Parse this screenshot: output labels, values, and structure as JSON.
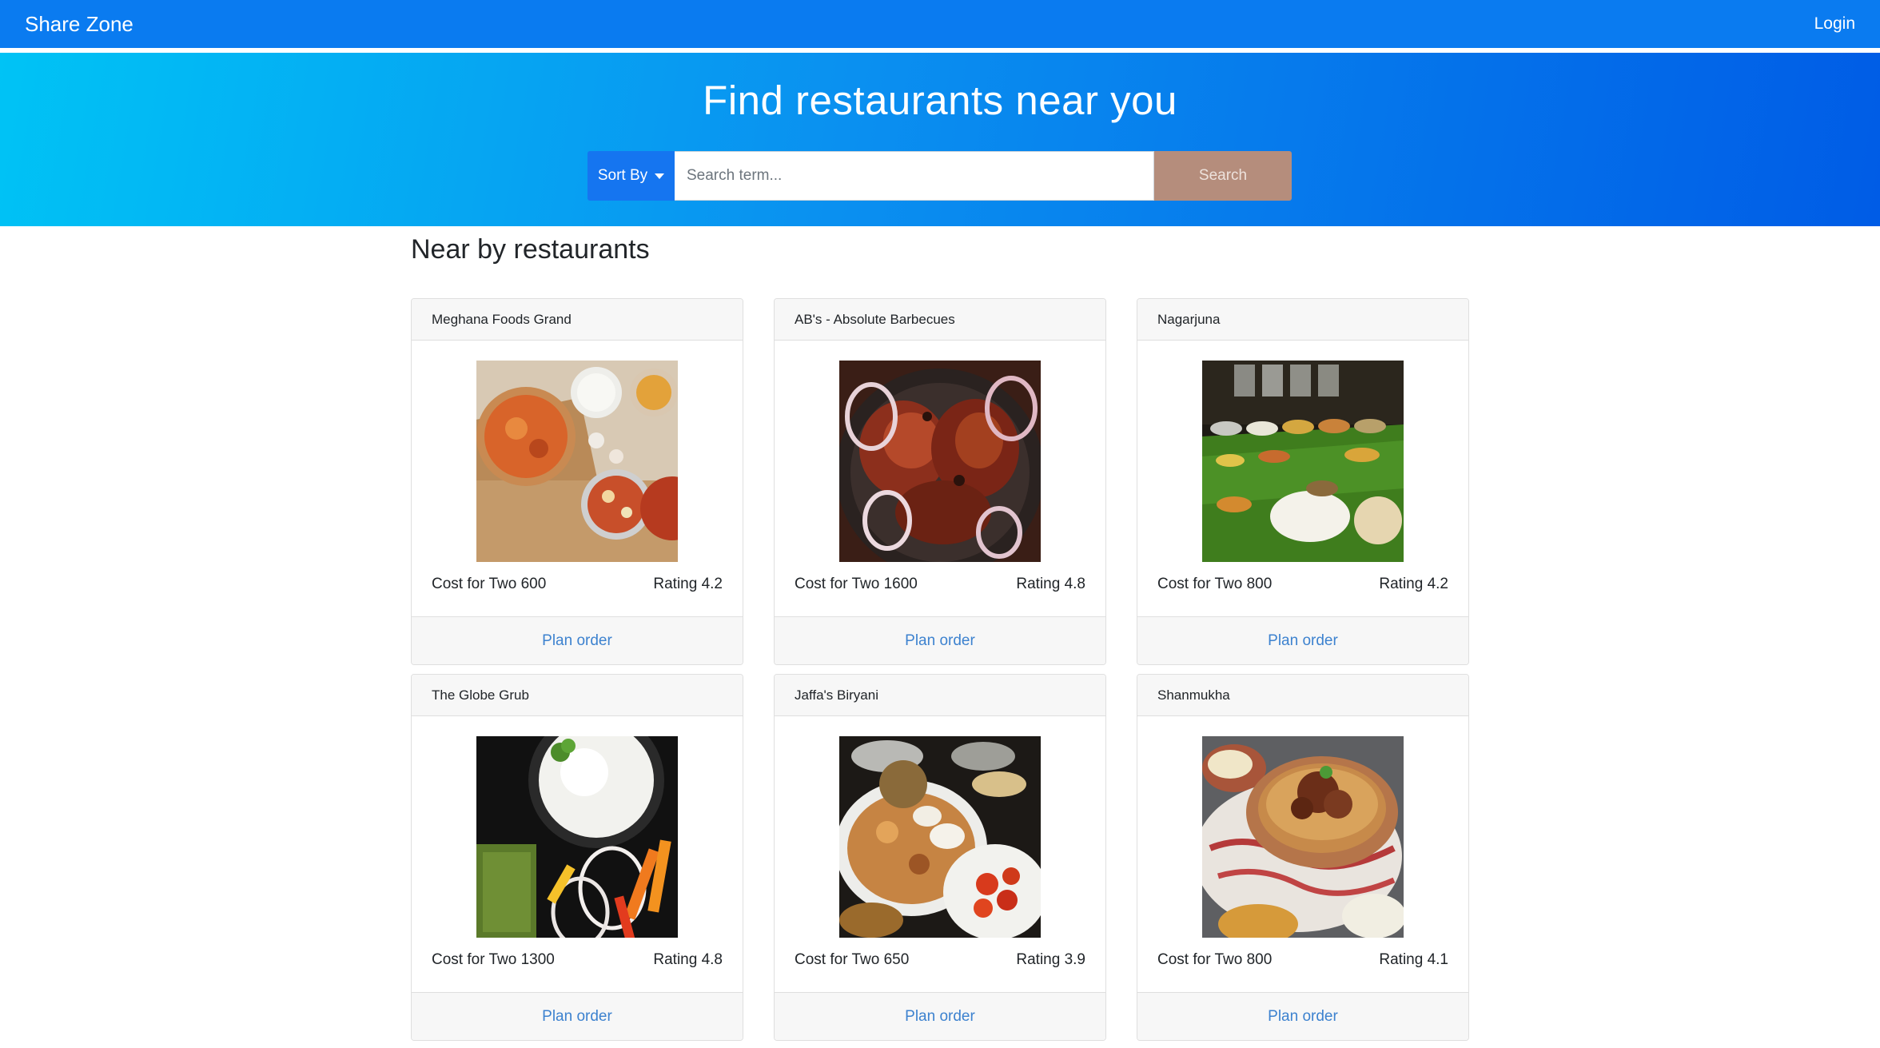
{
  "navbar": {
    "brand": "Share Zone",
    "login": "Login"
  },
  "hero": {
    "title": "Find restaurants near you",
    "sort_label": "Sort By",
    "search_placeholder": "Search term...",
    "search_button": "Search"
  },
  "section": {
    "title": "Near by restaurants"
  },
  "restaurants": [
    {
      "name": "Meghana Foods Grand",
      "cost": "Cost for Two 600",
      "rating": "Rating 4.2",
      "action": "Plan order",
      "image": "biryani-thali-photo"
    },
    {
      "name": "AB's - Absolute Barbecues",
      "cost": "Cost for Two 1600",
      "rating": "Rating 4.8",
      "action": "Plan order",
      "image": "grilled-chicken-photo"
    },
    {
      "name": "Nagarjuna",
      "cost": "Cost for Two 800",
      "rating": "Rating 4.2",
      "action": "Plan order",
      "image": "banana-leaf-meal-photo"
    },
    {
      "name": "The Globe Grub",
      "cost": "Cost for Two 1300",
      "rating": "Rating 4.8",
      "action": "Plan order",
      "image": "raita-salad-photo"
    },
    {
      "name": "Jaffa's Biryani",
      "cost": "Cost for Two 650",
      "rating": "Rating 3.9",
      "action": "Plan order",
      "image": "biryani-platter-photo"
    },
    {
      "name": "Shanmukha",
      "cost": "Cost for Two 800",
      "rating": "Rating 4.1",
      "action": "Plan order",
      "image": "mutton-biryani-pot-photo"
    }
  ],
  "colors": {
    "navbar": "#0a7bf0",
    "hero_start": "#00c3f5",
    "hero_end": "#005ce6",
    "sort_button": "#1575f0",
    "search_button": "#b58d7c",
    "link": "#3d82cf"
  }
}
